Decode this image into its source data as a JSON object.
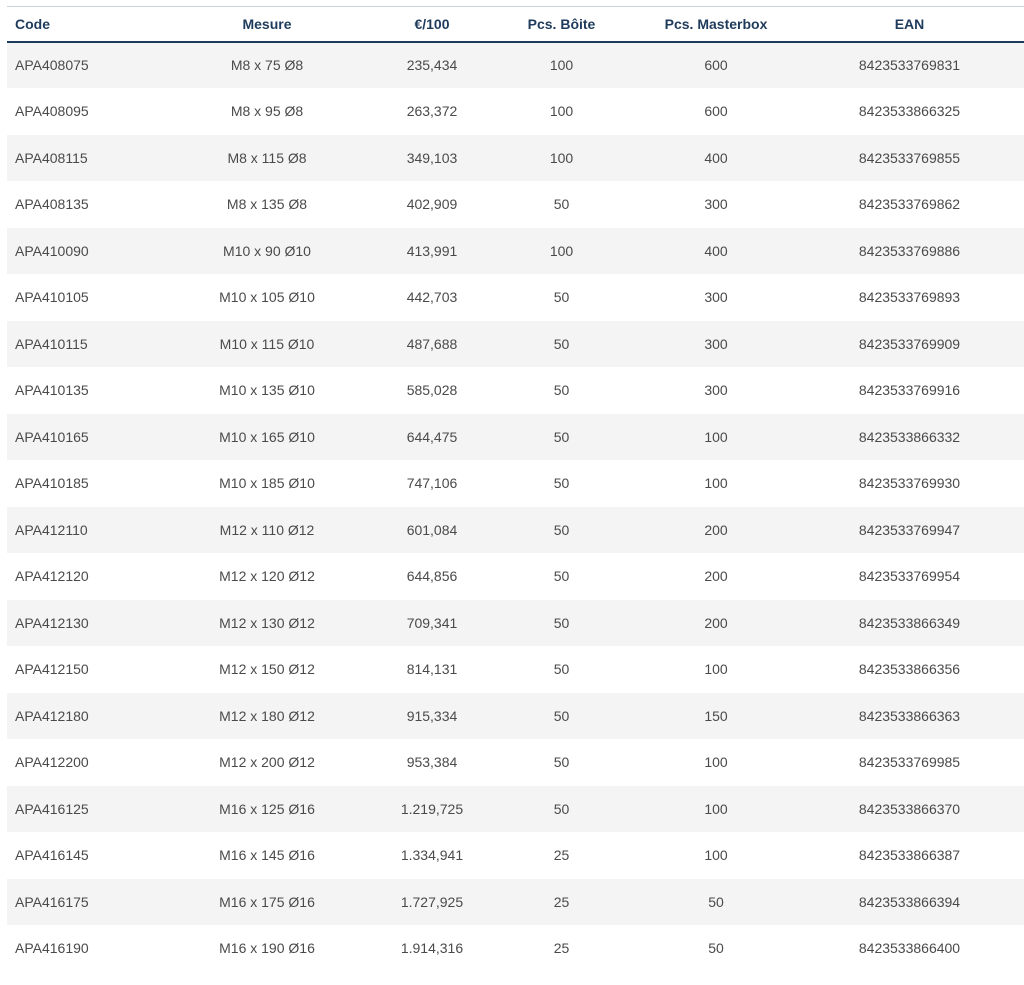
{
  "table": {
    "headers": [
      "Code",
      "Mesure",
      "€/100",
      "Pcs. Bôite",
      "Pcs. Masterbox",
      "EAN"
    ],
    "rows": [
      [
        "APA408075",
        "M8 x 75 Ø8",
        "235,434",
        "100",
        "600",
        "8423533769831"
      ],
      [
        "APA408095",
        "M8 x 95 Ø8",
        "263,372",
        "100",
        "600",
        "8423533866325"
      ],
      [
        "APA408115",
        "M8 x 115 Ø8",
        "349,103",
        "100",
        "400",
        "8423533769855"
      ],
      [
        "APA408135",
        "M8 x 135 Ø8",
        "402,909",
        "50",
        "300",
        "8423533769862"
      ],
      [
        "APA410090",
        "M10 x 90 Ø10",
        "413,991",
        "100",
        "400",
        "8423533769886"
      ],
      [
        "APA410105",
        "M10 x 105 Ø10",
        "442,703",
        "50",
        "300",
        "8423533769893"
      ],
      [
        "APA410115",
        "M10 x 115 Ø10",
        "487,688",
        "50",
        "300",
        "8423533769909"
      ],
      [
        "APA410135",
        "M10 x 135 Ø10",
        "585,028",
        "50",
        "300",
        "8423533769916"
      ],
      [
        "APA410165",
        "M10 x 165 Ø10",
        "644,475",
        "50",
        "100",
        "8423533866332"
      ],
      [
        "APA410185",
        "M10 x 185 Ø10",
        "747,106",
        "50",
        "100",
        "8423533769930"
      ],
      [
        "APA412110",
        "M12 x 110 Ø12",
        "601,084",
        "50",
        "200",
        "8423533769947"
      ],
      [
        "APA412120",
        "M12 x 120 Ø12",
        "644,856",
        "50",
        "200",
        "8423533769954"
      ],
      [
        "APA412130",
        "M12 x 130 Ø12",
        "709,341",
        "50",
        "200",
        "8423533866349"
      ],
      [
        "APA412150",
        "M12 x 150 Ø12",
        "814,131",
        "50",
        "100",
        "8423533866356"
      ],
      [
        "APA412180",
        "M12 x 180 Ø12",
        "915,334",
        "50",
        "150",
        "8423533866363"
      ],
      [
        "APA412200",
        "M12 x 200 Ø12",
        "953,384",
        "50",
        "100",
        "8423533769985"
      ],
      [
        "APA416125",
        "M16 x 125 Ø16",
        "1.219,725",
        "50",
        "100",
        "8423533866370"
      ],
      [
        "APA416145",
        "M16 x 145 Ø16",
        "1.334,941",
        "25",
        "100",
        "8423533866387"
      ],
      [
        "APA416175",
        "M16 x 175 Ø16",
        "1.727,925",
        "25",
        "50",
        "8423533866394"
      ],
      [
        "APA416190",
        "M16 x 190 Ø16",
        "1.914,316",
        "25",
        "50",
        "8423533866400"
      ]
    ]
  }
}
